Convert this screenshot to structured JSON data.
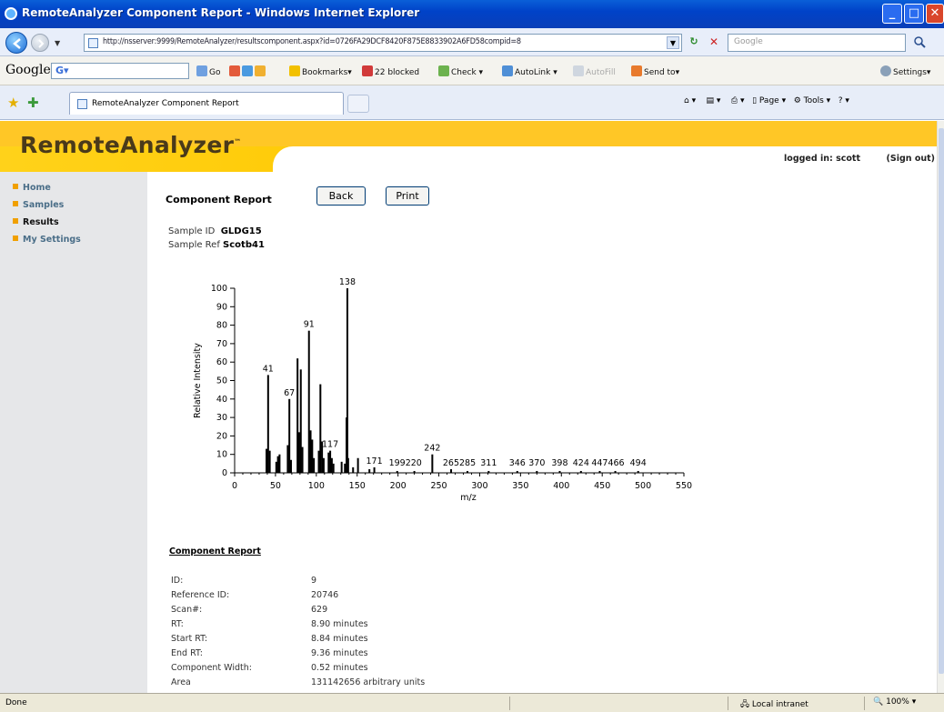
{
  "window": {
    "title": "RemoteAnalyzer Component Report - Windows Internet Explorer"
  },
  "address": {
    "url": "http://nsserver:9999/RemoteAnalyzer/resultscomponent.aspx?id=0726FA29DCF8420F875E8833902A6FD58compid=8",
    "search_placeholder": "Google"
  },
  "google_toolbar": {
    "logo": "Google",
    "go": "Go",
    "bookmarks": "Bookmarks",
    "blocked": "22 blocked",
    "check": "Check",
    "autolink": "AutoLink",
    "autofill": "AutoFill",
    "sendto": "Send to",
    "settings": "Settings"
  },
  "tabs": {
    "active_label": "RemoteAnalyzer Component Report",
    "page": "Page",
    "tools": "Tools"
  },
  "header": {
    "logo": "RemoteAnalyzer",
    "tm": "™",
    "logged_in": "logged in: scott",
    "sign_out": "(Sign out)"
  },
  "sidebar": {
    "items": [
      {
        "label": "Home",
        "active": false
      },
      {
        "label": "Samples",
        "active": false
      },
      {
        "label": "Results",
        "active": true
      },
      {
        "label": "My Settings",
        "active": false
      }
    ]
  },
  "content": {
    "title": "Component Report",
    "back_button": "Back",
    "print_button": "Print",
    "sample_id_label": "Sample ID",
    "sample_id": "GLDG15",
    "sample_ref_label": "Sample Ref",
    "sample_ref": "Scotb41"
  },
  "chart_data": {
    "type": "bar",
    "xlabel": "m/z",
    "ylabel": "Relative Intensity",
    "xlim": [
      0,
      550
    ],
    "ylim": [
      0,
      100
    ],
    "xticks": [
      0,
      50,
      100,
      150,
      200,
      250,
      300,
      350,
      400,
      450,
      500,
      550
    ],
    "yticks": [
      0,
      10,
      20,
      30,
      40,
      50,
      60,
      70,
      80,
      90,
      100
    ],
    "peaks": [
      {
        "x": 39,
        "y": 13
      },
      {
        "x": 41,
        "y": 53
      },
      {
        "x": 43,
        "y": 12
      },
      {
        "x": 51,
        "y": 6
      },
      {
        "x": 53,
        "y": 9
      },
      {
        "x": 55,
        "y": 10
      },
      {
        "x": 65,
        "y": 15
      },
      {
        "x": 67,
        "y": 40
      },
      {
        "x": 69,
        "y": 7
      },
      {
        "x": 77,
        "y": 62
      },
      {
        "x": 79,
        "y": 22
      },
      {
        "x": 81,
        "y": 56
      },
      {
        "x": 83,
        "y": 14
      },
      {
        "x": 91,
        "y": 77
      },
      {
        "x": 93,
        "y": 23
      },
      {
        "x": 95,
        "y": 18
      },
      {
        "x": 97,
        "y": 8
      },
      {
        "x": 103,
        "y": 12
      },
      {
        "x": 105,
        "y": 48
      },
      {
        "x": 107,
        "y": 17
      },
      {
        "x": 109,
        "y": 8
      },
      {
        "x": 115,
        "y": 11
      },
      {
        "x": 117,
        "y": 12
      },
      {
        "x": 119,
        "y": 8
      },
      {
        "x": 121,
        "y": 5
      },
      {
        "x": 131,
        "y": 6
      },
      {
        "x": 135,
        "y": 5
      },
      {
        "x": 137,
        "y": 30
      },
      {
        "x": 138,
        "y": 100
      },
      {
        "x": 139,
        "y": 8
      },
      {
        "x": 145,
        "y": 3
      },
      {
        "x": 151,
        "y": 8
      },
      {
        "x": 165,
        "y": 2
      },
      {
        "x": 171,
        "y": 3
      },
      {
        "x": 199,
        "y": 1
      },
      {
        "x": 220,
        "y": 1
      },
      {
        "x": 242,
        "y": 10
      },
      {
        "x": 265,
        "y": 2
      },
      {
        "x": 285,
        "y": 1
      },
      {
        "x": 311,
        "y": 1
      },
      {
        "x": 346,
        "y": 1
      },
      {
        "x": 370,
        "y": 1
      },
      {
        "x": 398,
        "y": 1
      },
      {
        "x": 424,
        "y": 1
      },
      {
        "x": 447,
        "y": 1
      },
      {
        "x": 466,
        "y": 1
      },
      {
        "x": 494,
        "y": 1
      }
    ],
    "labels": [
      {
        "text": "138",
        "x": 138,
        "y": 100
      },
      {
        "text": "91",
        "x": 91,
        "y": 77
      },
      {
        "text": "41",
        "x": 41,
        "y": 53
      },
      {
        "text": "67",
        "x": 67,
        "y": 40
      },
      {
        "text": "117",
        "x": 117,
        "y": 12
      },
      {
        "text": "171",
        "x": 171,
        "y": 3
      },
      {
        "text": "199220",
        "x": 209,
        "y": 2
      },
      {
        "text": "242",
        "x": 242,
        "y": 10
      },
      {
        "text": "265285",
        "x": 275,
        "y": 2
      },
      {
        "text": "311",
        "x": 311,
        "y": 2
      },
      {
        "text": "346",
        "x": 346,
        "y": 2
      },
      {
        "text": "370",
        "x": 370,
        "y": 2
      },
      {
        "text": "398",
        "x": 398,
        "y": 2
      },
      {
        "text": "424",
        "x": 424,
        "y": 2
      },
      {
        "text": "447466",
        "x": 457,
        "y": 2
      },
      {
        "text": "494",
        "x": 494,
        "y": 2
      }
    ]
  },
  "report": {
    "heading": "Component Report",
    "rows": [
      {
        "label": "ID:",
        "value": "9"
      },
      {
        "label": "Reference ID:",
        "value": "20746"
      },
      {
        "label": "Scan#:",
        "value": "629"
      },
      {
        "label": "RT:",
        "value": "8.90 minutes"
      },
      {
        "label": "Start RT:",
        "value": "8.84 minutes"
      },
      {
        "label": "End RT:",
        "value": "9.36 minutes"
      },
      {
        "label": "Component Width:",
        "value": "0.52 minutes"
      },
      {
        "label": "Area",
        "value": "131142656 arbitrary units"
      }
    ]
  },
  "statusbar": {
    "done": "Done",
    "zone": "Local intranet",
    "zoom": "100%"
  }
}
